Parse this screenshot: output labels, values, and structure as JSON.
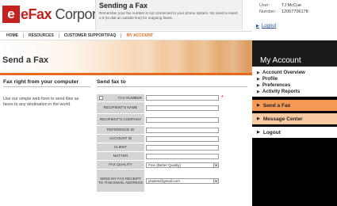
{
  "brand": {
    "logo_mark": "e",
    "logo_e": "eFax",
    "logo_rest": " Corporate"
  },
  "notice": {
    "title": "Sending a Fax",
    "text": "Remember your fax number is not connected to your phone system. No need to insert a 9 (to dial an outside line) for outgoing faxes."
  },
  "user": {
    "user_key": "User:",
    "user_value": "TJ  McCue",
    "number_key": "Number:",
    "number_value": "12067706178",
    "logout": "Logout"
  },
  "nav": {
    "items": [
      "HOME",
      "RESOURCES",
      "CUSTOMER SUPPORT/FAQ",
      "MY ACCOUNT"
    ],
    "active_index": 3
  },
  "banner": {
    "title": "Send a Fax"
  },
  "account": {
    "title": "My Account",
    "links": [
      "Account Overview",
      "Profile",
      "Preferences",
      "Activity Reports"
    ],
    "buttons": [
      "Send a Fax",
      "Message Center",
      "Logout"
    ]
  },
  "intro": {
    "heading": "Fax right from your computer",
    "text": "Use our simple web form to send files as faxes to any destination in the world."
  },
  "form": {
    "heading": "Send fax to",
    "fields": [
      {
        "label": "FAX NUMBER",
        "value": "",
        "required": true
      },
      {
        "label": "RECIPIENT'S NAME",
        "value": ""
      },
      {
        "label": "RECIPIENT'S COMPANY",
        "value": ""
      },
      {
        "label": "REFERENCE ID",
        "value": ""
      },
      {
        "label": "ACCOUNT ID",
        "value": ""
      },
      {
        "label": "CLIENT",
        "value": ""
      },
      {
        "label": "MATTER",
        "value": ""
      }
    ],
    "fax_quality": {
      "label": "FAX QUALITY",
      "value": "Fine (Better Quality)"
    },
    "receipt": {
      "label": "SEND MY FAX RECEIPT TO THIS EMAIL ADDRESS",
      "value": "j4sales@gmail.com"
    },
    "required_mark": "*"
  },
  "colors": {
    "accent": "#e8681e",
    "brand_red": "#c7211f"
  }
}
